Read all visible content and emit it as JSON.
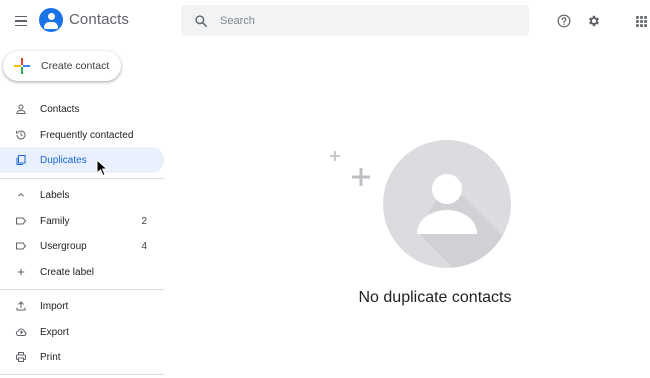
{
  "header": {
    "app_title": "Contacts",
    "search_placeholder": "Search",
    "search_value": ""
  },
  "create_button": {
    "label": "Create contact"
  },
  "sidebar": {
    "primary": [
      {
        "label": "Contacts",
        "icon": "person-icon",
        "active": false
      },
      {
        "label": "Frequently contacted",
        "icon": "history-icon",
        "active": false
      },
      {
        "label": "Duplicates",
        "icon": "duplicates-icon",
        "active": true
      }
    ],
    "labels_header": "Labels",
    "labels": [
      {
        "label": "Family",
        "count": "2",
        "icon": "label-icon"
      },
      {
        "label": "Usergroup",
        "count": "4",
        "icon": "label-icon"
      }
    ],
    "create_label": "Create label",
    "tools": [
      {
        "label": "Import",
        "icon": "upload-icon"
      },
      {
        "label": "Export",
        "icon": "cloud-upload-icon"
      },
      {
        "label": "Print",
        "icon": "print-icon"
      }
    ]
  },
  "main": {
    "empty_message": "No duplicate contacts"
  },
  "colors": {
    "accent": "#1a73e8",
    "active_bg": "#e8f0fe",
    "active_text": "#1967d2",
    "search_bg": "#f1f3f4",
    "illustration_bg": "#dadce0"
  }
}
